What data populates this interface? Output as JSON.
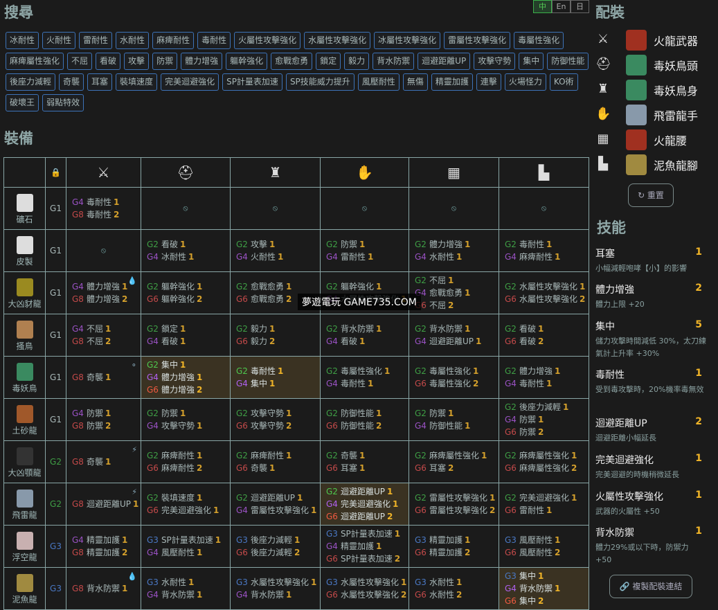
{
  "search": {
    "title": "搜尋",
    "tags": [
      "冰耐性",
      "火耐性",
      "雷耐性",
      "水耐性",
      "麻痺耐性",
      "毒耐性",
      "火屬性攻擊強化",
      "水屬性攻擊強化",
      "冰屬性攻擊強化",
      "雷屬性攻擊強化",
      "毒屬性強化",
      "麻痺屬性強化",
      "不屈",
      "看破",
      "攻擊",
      "防禦",
      "體力增強",
      "軀幹強化",
      "愈戰愈勇",
      "鎖定",
      "毅力",
      "背水防禦",
      "迴避距離UP",
      "攻擊守勢",
      "集中",
      "防御性能",
      "後座力減輕",
      "奇襲",
      "耳塞",
      "裝填速度",
      "完美迴避強化",
      "SP計量表加速",
      "SP技能威力提升",
      "風壓耐性",
      "無傷",
      "精靈加護",
      "連擊",
      "火場怪力",
      "KO術",
      "破壞王",
      "弱點特效"
    ]
  },
  "lang": {
    "items": [
      "中",
      "En",
      "日"
    ],
    "active": "中"
  },
  "equip": {
    "title": "裝備",
    "none_symbol": "⦸",
    "header_icons": [
      "lock-icon",
      "weapon-icon",
      "helm-icon",
      "chest-icon",
      "arms-icon",
      "waist-icon",
      "legs-icon"
    ],
    "rows": [
      {
        "monster": "礦石",
        "grade": "G1",
        "color": "#ddd",
        "deco": null,
        "cells": [
          [
            [
              "G4",
              "毒耐性",
              "1"
            ],
            [
              "G8",
              "毒耐性",
              "2"
            ]
          ],
          null,
          null,
          null,
          null,
          null
        ]
      },
      {
        "monster": "皮製",
        "grade": "G1",
        "color": "#ddd",
        "deco": null,
        "cells": [
          null,
          [
            [
              "G2",
              "看破",
              "1"
            ],
            [
              "G4",
              "冰耐性",
              "1"
            ]
          ],
          [
            [
              "G2",
              "攻擊",
              "1"
            ],
            [
              "G4",
              "火耐性",
              "1"
            ]
          ],
          [
            [
              "G2",
              "防禦",
              "1"
            ],
            [
              "G4",
              "雷耐性",
              "1"
            ]
          ],
          [
            [
              "G2",
              "體力增強",
              "1"
            ],
            [
              "G4",
              "水耐性",
              "1"
            ]
          ],
          [
            [
              "G2",
              "毒耐性",
              "1"
            ],
            [
              "G4",
              "麻痺耐性",
              "1"
            ]
          ]
        ]
      },
      {
        "monster": "大凶豺龍",
        "grade": "G1",
        "color": "#9a8a20",
        "deco": "💧",
        "cells": [
          [
            [
              "G4",
              "體力增強",
              "1"
            ],
            [
              "G8",
              "體力增強",
              "2"
            ]
          ],
          [
            [
              "G2",
              "軀幹強化",
              "1"
            ],
            [
              "G6",
              "軀幹強化",
              "2"
            ]
          ],
          [
            [
              "G2",
              "愈戰愈勇",
              "1"
            ],
            [
              "G6",
              "愈戰愈勇",
              "2"
            ]
          ],
          [
            [
              "G2",
              "軀幹強化",
              "1"
            ],
            [
              "G4",
              "水屬性攻擊強化",
              "1"
            ]
          ],
          [
            [
              "G2",
              "不屈",
              "1"
            ],
            [
              "G4",
              "愈戰愈勇",
              "1"
            ],
            [
              "G6",
              "不屈",
              "2"
            ]
          ],
          [
            [
              "G2",
              "水屬性攻擊強化",
              "1"
            ],
            [
              "G6",
              "水屬性攻擊強化",
              "2"
            ]
          ]
        ]
      },
      {
        "monster": "搔鳥",
        "grade": "G1",
        "color": "#b08050",
        "deco": null,
        "cells": [
          [
            [
              "G4",
              "不屈",
              "1"
            ],
            [
              "G8",
              "不屈",
              "2"
            ]
          ],
          [
            [
              "G2",
              "鎖定",
              "1"
            ],
            [
              "G4",
              "看破",
              "1"
            ]
          ],
          [
            [
              "G2",
              "毅力",
              "1"
            ],
            [
              "G6",
              "毅力",
              "2"
            ]
          ],
          [
            [
              "G2",
              "背水防禦",
              "1"
            ],
            [
              "G4",
              "看破",
              "1"
            ]
          ],
          [
            [
              "G2",
              "背水防禦",
              "1"
            ],
            [
              "G4",
              "迴避距離UP",
              "1"
            ]
          ],
          [
            [
              "G2",
              "看破",
              "1"
            ],
            [
              "G6",
              "看破",
              "2"
            ]
          ]
        ]
      },
      {
        "monster": "毒妖鳥",
        "grade": "G1",
        "color": "#3a8a60",
        "deco": "⚬",
        "hl": [
          1,
          2
        ],
        "cells": [
          [
            [
              "G8",
              "奇襲",
              "1"
            ]
          ],
          [
            [
              "G2",
              "集中",
              "1"
            ],
            [
              "G4",
              "體力增強",
              "1"
            ],
            [
              "G6",
              "體力增強",
              "2"
            ]
          ],
          [
            [
              "G2",
              "毒耐性",
              "1"
            ],
            [
              "G4",
              "集中",
              "1"
            ]
          ],
          [
            [
              "G2",
              "毒屬性強化",
              "1"
            ],
            [
              "G4",
              "毒耐性",
              "1"
            ]
          ],
          [
            [
              "G2",
              "毒屬性強化",
              "1"
            ],
            [
              "G6",
              "毒屬性強化",
              "2"
            ]
          ],
          [
            [
              "G2",
              "體力增強",
              "1"
            ],
            [
              "G4",
              "毒耐性",
              "1"
            ]
          ]
        ]
      },
      {
        "monster": "土砂龍",
        "grade": "G1",
        "color": "#a0582a",
        "deco": null,
        "cells": [
          [
            [
              "G4",
              "防禦",
              "1"
            ],
            [
              "G8",
              "防禦",
              "2"
            ]
          ],
          [
            [
              "G2",
              "防禦",
              "1"
            ],
            [
              "G4",
              "攻擊守勢",
              "1"
            ]
          ],
          [
            [
              "G2",
              "攻擊守勢",
              "1"
            ],
            [
              "G6",
              "攻擊守勢",
              "2"
            ]
          ],
          [
            [
              "G2",
              "防御性能",
              "1"
            ],
            [
              "G6",
              "防御性能",
              "2"
            ]
          ],
          [
            [
              "G2",
              "防禦",
              "1"
            ],
            [
              "G4",
              "防御性能",
              "1"
            ]
          ],
          [
            [
              "G2",
              "後座力減輕",
              "1"
            ],
            [
              "G4",
              "防禦",
              "1"
            ],
            [
              "G6",
              "防禦",
              "2"
            ]
          ]
        ]
      },
      {
        "monster": "大凶顎龍",
        "grade": "G2",
        "color": "#333",
        "deco": "⚡",
        "cells": [
          [
            [
              "G8",
              "奇襲",
              "1"
            ]
          ],
          [
            [
              "G2",
              "麻痺耐性",
              "1"
            ],
            [
              "G6",
              "麻痺耐性",
              "2"
            ]
          ],
          [
            [
              "G2",
              "麻痺耐性",
              "1"
            ],
            [
              "G6",
              "奇襲",
              "1"
            ]
          ],
          [
            [
              "G2",
              "奇襲",
              "1"
            ],
            [
              "G6",
              "耳塞",
              "1"
            ]
          ],
          [
            [
              "G2",
              "麻痺屬性強化",
              "1"
            ],
            [
              "G6",
              "耳塞",
              "2"
            ]
          ],
          [
            [
              "G2",
              "麻痺屬性強化",
              "1"
            ],
            [
              "G6",
              "麻痺屬性強化",
              "2"
            ]
          ]
        ]
      },
      {
        "monster": "飛雷龍",
        "grade": "G2",
        "color": "#8899aa",
        "deco": "⚡",
        "hl": [
          3
        ],
        "cells": [
          [
            [
              "G8",
              "迴避距離UP",
              "1"
            ]
          ],
          [
            [
              "G2",
              "裝填速度",
              "1"
            ],
            [
              "G6",
              "完美迴避強化",
              "1"
            ]
          ],
          [
            [
              "G2",
              "迴避距離UP",
              "1"
            ],
            [
              "G4",
              "雷屬性攻擊強化",
              "1"
            ]
          ],
          [
            [
              "G2",
              "迴避距離UP",
              "1"
            ],
            [
              "G4",
              "完美迴避強化",
              "1"
            ],
            [
              "G6",
              "迴避距離UP",
              "2"
            ]
          ],
          [
            [
              "G2",
              "雷屬性攻擊強化",
              "1"
            ],
            [
              "G6",
              "雷屬性攻擊強化",
              "2"
            ]
          ],
          [
            [
              "G2",
              "完美迴避強化",
              "1"
            ],
            [
              "G6",
              "雷耐性",
              "1"
            ]
          ]
        ]
      },
      {
        "monster": "浮空龍",
        "grade": "G3",
        "color": "#c8b0b0",
        "deco": null,
        "cells": [
          [
            [
              "G4",
              "精靈加護",
              "1"
            ],
            [
              "G8",
              "精靈加護",
              "2"
            ]
          ],
          [
            [
              "G3",
              "SP計量表加速",
              "1"
            ],
            [
              "G4",
              "風壓耐性",
              "1"
            ]
          ],
          [
            [
              "G3",
              "後座力減輕",
              "1"
            ],
            [
              "G6",
              "後座力減輕",
              "2"
            ]
          ],
          [
            [
              "G3",
              "SP計量表加速",
              "1"
            ],
            [
              "G4",
              "精靈加護",
              "1"
            ],
            [
              "G6",
              "SP計量表加速",
              "2"
            ]
          ],
          [
            [
              "G3",
              "精靈加護",
              "1"
            ],
            [
              "G6",
              "精靈加護",
              "2"
            ]
          ],
          [
            [
              "G3",
              "風壓耐性",
              "1"
            ],
            [
              "G6",
              "風壓耐性",
              "2"
            ]
          ]
        ]
      },
      {
        "monster": "泥魚龍",
        "grade": "G3",
        "color": "#a08a40",
        "deco": "💧",
        "hl": [
          5
        ],
        "cells": [
          [
            [
              "G8",
              "背水防禦",
              "1"
            ]
          ],
          [
            [
              "G3",
              "水耐性",
              "1"
            ],
            [
              "G4",
              "背水防禦",
              "1"
            ]
          ],
          [
            [
              "G3",
              "水屬性攻擊強化",
              "1"
            ],
            [
              "G4",
              "背水防禦",
              "1"
            ]
          ],
          [
            [
              "G3",
              "水屬性攻擊強化",
              "1"
            ],
            [
              "G6",
              "水屬性攻擊強化",
              "2"
            ]
          ],
          [
            [
              "G3",
              "水耐性",
              "1"
            ],
            [
              "G6",
              "水耐性",
              "2"
            ]
          ],
          [
            [
              "G3",
              "集中",
              "1"
            ],
            [
              "G4",
              "背水防禦",
              "1"
            ],
            [
              "G6",
              "集中",
              "2"
            ]
          ]
        ]
      }
    ]
  },
  "loadout": {
    "title": "配裝",
    "items": [
      {
        "slot": "weapon",
        "name": "火龍武器",
        "color": "#a03020"
      },
      {
        "slot": "helm",
        "name": "毒妖鳥頭",
        "color": "#3a8a60"
      },
      {
        "slot": "chest",
        "name": "毒妖鳥身",
        "color": "#3a8a60"
      },
      {
        "slot": "arms",
        "name": "飛雷龍手",
        "color": "#8899aa"
      },
      {
        "slot": "waist",
        "name": "火龍腰",
        "color": "#a03020"
      },
      {
        "slot": "legs",
        "name": "泥魚龍腳",
        "color": "#a08a40"
      }
    ],
    "reset_label": "↻ 重置"
  },
  "skills": {
    "title": "技能",
    "items": [
      {
        "name": "耳塞",
        "level": "1",
        "desc": "小幅減輕咆哮【小】的影響"
      },
      {
        "name": "體力增強",
        "level": "2",
        "desc": "體力上限 +20"
      },
      {
        "name": "集中",
        "level": "5",
        "desc": "儲力攻擊時間減低 30%，太刀練氣計上升率 +30%"
      },
      {
        "name": "毒耐性",
        "level": "1",
        "desc": "受到毒攻擊時，20%機率毒無效"
      },
      {
        "name": "迴避距離UP",
        "level": "2",
        "desc": "迴避距離小幅延長"
      },
      {
        "name": "完美迴避強化",
        "level": "1",
        "desc": "完美迴避的時機稍微延長"
      },
      {
        "name": "火屬性攻擊強化",
        "level": "1",
        "desc": "武器的火屬性 +50"
      },
      {
        "name": "背水防禦",
        "level": "1",
        "desc": "體力29%或以下時，防禦力 +50"
      }
    ],
    "copy_label": "🔗 複製配裝連結"
  },
  "watermark": "夢遊電玩 GAME735.COM"
}
